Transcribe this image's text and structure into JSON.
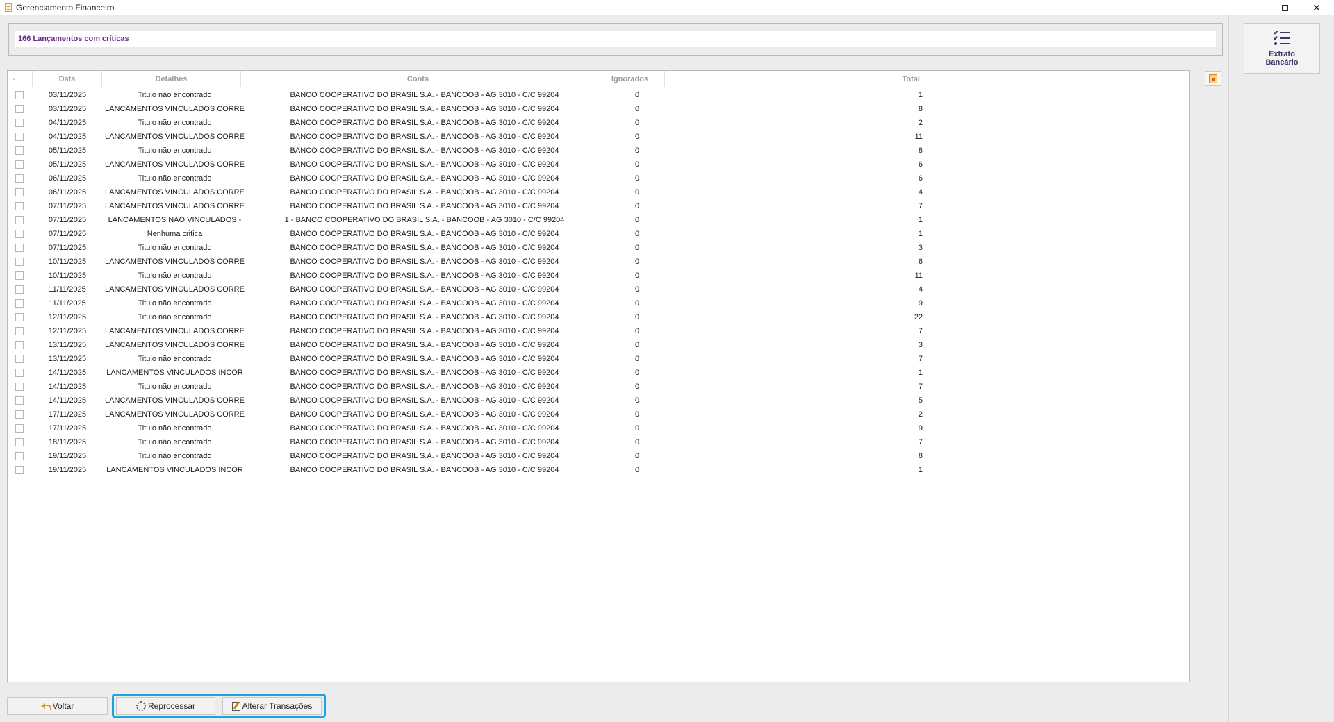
{
  "window": {
    "title": "Gerenciamento Financeiro",
    "controls": [
      "minimize-icon",
      "restore-icon",
      "close-icon"
    ]
  },
  "header": {
    "critic_summary": "166 Lançamentos com críticas"
  },
  "side_panel": {
    "extrato_label": "Extrato\nBancário"
  },
  "grid": {
    "columns": {
      "select": "-",
      "data": "Data",
      "detalhes": "Detalhes",
      "conta": "Conta",
      "ignorados": "Ignorados",
      "total": "Total"
    },
    "rows": [
      {
        "data": "03/11/2025",
        "detalhes": "Titulo não encontrado",
        "conta": "BANCO COOPERATIVO DO BRASIL S.A. - BANCOOB - AG 3010 - C/C 99204",
        "ignorados": "0",
        "total": "1"
      },
      {
        "data": "03/11/2025",
        "detalhes": "LANCAMENTOS VINCULADOS CORRE",
        "conta": "BANCO COOPERATIVO DO BRASIL S.A. - BANCOOB - AG 3010 - C/C 99204",
        "ignorados": "0",
        "total": "8"
      },
      {
        "data": "04/11/2025",
        "detalhes": "Titulo não encontrado",
        "conta": "BANCO COOPERATIVO DO BRASIL S.A. - BANCOOB - AG 3010 - C/C 99204",
        "ignorados": "0",
        "total": "2"
      },
      {
        "data": "04/11/2025",
        "detalhes": "LANCAMENTOS VINCULADOS CORRE",
        "conta": "BANCO COOPERATIVO DO BRASIL S.A. - BANCOOB - AG 3010 - C/C 99204",
        "ignorados": "0",
        "total": "11"
      },
      {
        "data": "05/11/2025",
        "detalhes": "Titulo não encontrado",
        "conta": "BANCO COOPERATIVO DO BRASIL S.A. - BANCOOB - AG 3010 - C/C 99204",
        "ignorados": "0",
        "total": "8"
      },
      {
        "data": "05/11/2025",
        "detalhes": "LANCAMENTOS VINCULADOS CORRE",
        "conta": "BANCO COOPERATIVO DO BRASIL S.A. - BANCOOB - AG 3010 - C/C 99204",
        "ignorados": "0",
        "total": "6"
      },
      {
        "data": "06/11/2025",
        "detalhes": "Titulo não encontrado",
        "conta": "BANCO COOPERATIVO DO BRASIL S.A. - BANCOOB - AG 3010 - C/C 99204",
        "ignorados": "0",
        "total": "6"
      },
      {
        "data": "06/11/2025",
        "detalhes": "LANCAMENTOS VINCULADOS CORRE",
        "conta": "BANCO COOPERATIVO DO BRASIL S.A. - BANCOOB - AG 3010 - C/C 99204",
        "ignorados": "0",
        "total": "4"
      },
      {
        "data": "07/11/2025",
        "detalhes": "LANCAMENTOS VINCULADOS CORRE",
        "conta": "BANCO COOPERATIVO DO BRASIL S.A. - BANCOOB - AG 3010 - C/C 99204",
        "ignorados": "0",
        "total": "7"
      },
      {
        "data": "07/11/2025",
        "detalhes": "LANCAMENTOS NAO VINCULADOS -",
        "conta": "1 - BANCO COOPERATIVO DO BRASIL S.A. - BANCOOB - AG 3010 - C/C 99204",
        "ignorados": "0",
        "total": "1"
      },
      {
        "data": "07/11/2025",
        "detalhes": "Nenhuma critica",
        "conta": "BANCO COOPERATIVO DO BRASIL S.A. - BANCOOB - AG 3010 - C/C 99204",
        "ignorados": "0",
        "total": "1"
      },
      {
        "data": "07/11/2025",
        "detalhes": "Titulo não encontrado",
        "conta": "BANCO COOPERATIVO DO BRASIL S.A. - BANCOOB - AG 3010 - C/C 99204",
        "ignorados": "0",
        "total": "3"
      },
      {
        "data": "10/11/2025",
        "detalhes": "LANCAMENTOS VINCULADOS CORRE",
        "conta": "BANCO COOPERATIVO DO BRASIL S.A. - BANCOOB - AG 3010 - C/C 99204",
        "ignorados": "0",
        "total": "6"
      },
      {
        "data": "10/11/2025",
        "detalhes": "Titulo não encontrado",
        "conta": "BANCO COOPERATIVO DO BRASIL S.A. - BANCOOB - AG 3010 - C/C 99204",
        "ignorados": "0",
        "total": "11"
      },
      {
        "data": "11/11/2025",
        "detalhes": "LANCAMENTOS VINCULADOS CORRE",
        "conta": "BANCO COOPERATIVO DO BRASIL S.A. - BANCOOB - AG 3010 - C/C 99204",
        "ignorados": "0",
        "total": "4"
      },
      {
        "data": "11/11/2025",
        "detalhes": "Titulo não encontrado",
        "conta": "BANCO COOPERATIVO DO BRASIL S.A. - BANCOOB - AG 3010 - C/C 99204",
        "ignorados": "0",
        "total": "9"
      },
      {
        "data": "12/11/2025",
        "detalhes": "Titulo não encontrado",
        "conta": "BANCO COOPERATIVO DO BRASIL S.A. - BANCOOB - AG 3010 - C/C 99204",
        "ignorados": "0",
        "total": "22"
      },
      {
        "data": "12/11/2025",
        "detalhes": "LANCAMENTOS VINCULADOS CORRE",
        "conta": "BANCO COOPERATIVO DO BRASIL S.A. - BANCOOB - AG 3010 - C/C 99204",
        "ignorados": "0",
        "total": "7"
      },
      {
        "data": "13/11/2025",
        "detalhes": "LANCAMENTOS VINCULADOS CORRE",
        "conta": "BANCO COOPERATIVO DO BRASIL S.A. - BANCOOB - AG 3010 - C/C 99204",
        "ignorados": "0",
        "total": "3"
      },
      {
        "data": "13/11/2025",
        "detalhes": "Titulo não encontrado",
        "conta": "BANCO COOPERATIVO DO BRASIL S.A. - BANCOOB - AG 3010 - C/C 99204",
        "ignorados": "0",
        "total": "7"
      },
      {
        "data": "14/11/2025",
        "detalhes": "LANCAMENTOS VINCULADOS INCOR",
        "conta": "BANCO COOPERATIVO DO BRASIL S.A. - BANCOOB - AG 3010 - C/C 99204",
        "ignorados": "0",
        "total": "1"
      },
      {
        "data": "14/11/2025",
        "detalhes": "Titulo não encontrado",
        "conta": "BANCO COOPERATIVO DO BRASIL S.A. - BANCOOB - AG 3010 - C/C 99204",
        "ignorados": "0",
        "total": "7"
      },
      {
        "data": "14/11/2025",
        "detalhes": "LANCAMENTOS VINCULADOS CORRE",
        "conta": "BANCO COOPERATIVO DO BRASIL S.A. - BANCOOB - AG 3010 - C/C 99204",
        "ignorados": "0",
        "total": "5"
      },
      {
        "data": "17/11/2025",
        "detalhes": "LANCAMENTOS VINCULADOS CORRE",
        "conta": "BANCO COOPERATIVO DO BRASIL S.A. - BANCOOB - AG 3010 - C/C 99204",
        "ignorados": "0",
        "total": "2"
      },
      {
        "data": "17/11/2025",
        "detalhes": "Titulo não encontrado",
        "conta": "BANCO COOPERATIVO DO BRASIL S.A. - BANCOOB - AG 3010 - C/C 99204",
        "ignorados": "0",
        "total": "9"
      },
      {
        "data": "18/11/2025",
        "detalhes": "Titulo não encontrado",
        "conta": "BANCO COOPERATIVO DO BRASIL S.A. - BANCOOB - AG 3010 - C/C 99204",
        "ignorados": "0",
        "total": "7"
      },
      {
        "data": "19/11/2025",
        "detalhes": "Titulo não encontrado",
        "conta": "BANCO COOPERATIVO DO BRASIL S.A. - BANCOOB - AG 3010 - C/C 99204",
        "ignorados": "0",
        "total": "8"
      },
      {
        "data": "19/11/2025",
        "detalhes": "LANCAMENTOS VINCULADOS INCOR",
        "conta": "BANCO COOPERATIVO DO BRASIL S.A. - BANCOOB - AG 3010 - C/C 99204",
        "ignorados": "0",
        "total": "1"
      }
    ]
  },
  "footer": {
    "voltar_label": "Voltar",
    "reprocessar_label": "Reprocessar",
    "alterar_label": "Alterar Transações",
    "highlight_color": "#1aa3e0"
  },
  "colors": {
    "critic_text": "#6a2c8c",
    "extrato_text": "#3a3a6a"
  }
}
